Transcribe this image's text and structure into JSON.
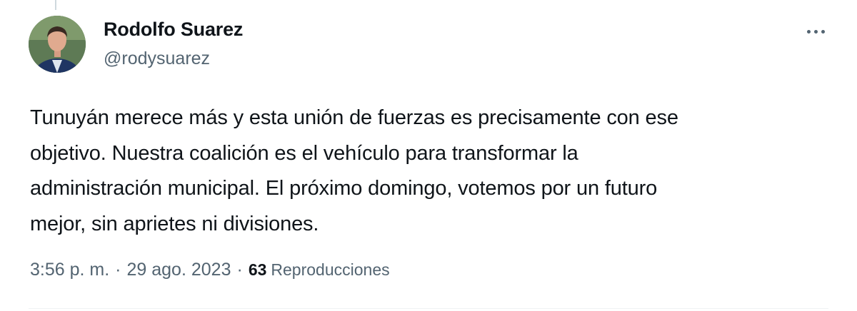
{
  "author": {
    "name": "Rodolfo Suarez",
    "handle": "@rodysuarez"
  },
  "tweet": {
    "text_lines": [
      "Tunuyán merece más y esta unión de fuerzas es precisamente con ese",
      "objetivo. Nuestra coalición es el vehículo para transformar la",
      "administración municipal. El próximo domingo, votemos por un futuro",
      "mejor, sin aprietes ni divisiones."
    ],
    "time": "3:56 p. m.",
    "separator": "·",
    "date": "29 ago. 2023",
    "views_count": "63",
    "views_label": "Reproducciones"
  },
  "icons": {
    "more": "more-horizontal-icon"
  },
  "colors": {
    "text_primary": "#0f1419",
    "text_secondary": "#536471",
    "divider": "#eff3f4"
  }
}
